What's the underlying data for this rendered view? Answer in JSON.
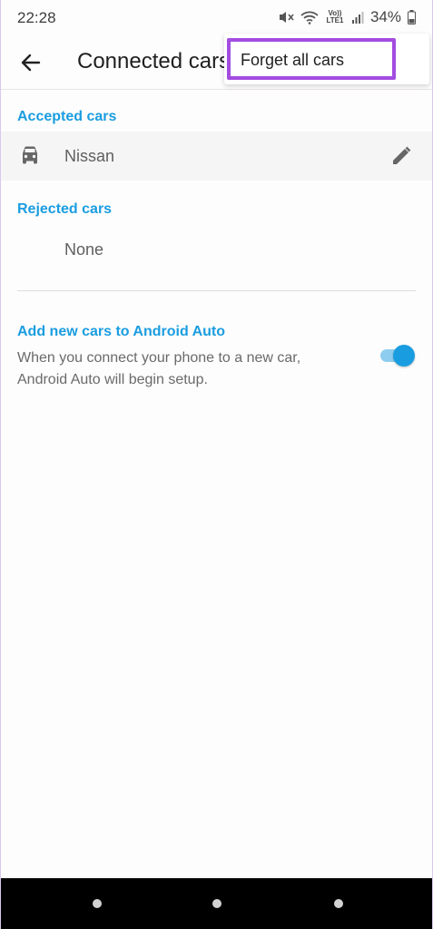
{
  "status_bar": {
    "time": "22:28",
    "network_label": "Vo)) LTE1",
    "battery": "34%",
    "icons": [
      "mute-icon",
      "wifi-icon",
      "signal-icon",
      "battery-icon"
    ]
  },
  "app_bar": {
    "title": "Connected cars",
    "back_icon": "arrow-left-icon"
  },
  "overflow_menu": {
    "items": [
      {
        "label": "Forget all cars"
      }
    ],
    "highlight_color": "#a34ce0"
  },
  "accepted": {
    "header": "Accepted cars",
    "cars": [
      {
        "name": "Nissan",
        "icon": "car-icon",
        "action_icon": "pencil-icon"
      }
    ]
  },
  "rejected": {
    "header": "Rejected cars",
    "empty_text": "None"
  },
  "add_new_cars": {
    "title": "Add new cars to Android Auto",
    "description": "When you connect your phone to a new car, Android Auto will begin setup.",
    "enabled": true
  },
  "colors": {
    "accent": "#1a9de0",
    "background": "#fefdfd",
    "nav_bar": "#000000"
  }
}
